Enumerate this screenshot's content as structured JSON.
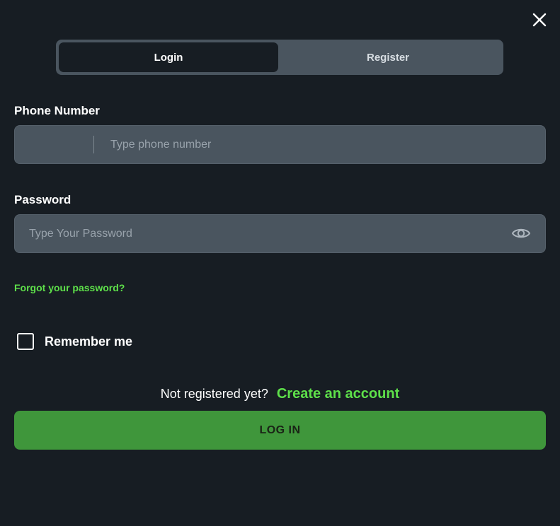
{
  "modal": {
    "close_icon": "close-icon"
  },
  "tabs": [
    {
      "label": "Login",
      "active": true
    },
    {
      "label": "Register",
      "active": false
    }
  ],
  "phone": {
    "label": "Phone Number",
    "placeholder": "Type phone number",
    "value": ""
  },
  "password": {
    "label": "Password",
    "placeholder": "Type Your Password",
    "value": "",
    "toggle_icon": "eye-icon"
  },
  "forgot_password": "Forgot your password?",
  "remember_me": {
    "label": "Remember me",
    "checked": false
  },
  "register_prompt": {
    "text": "Not registered yet?",
    "link": "Create an account"
  },
  "submit": {
    "label": "LOG IN"
  },
  "colors": {
    "background": "#171d23",
    "input_bg": "#4a555f",
    "accent_green": "#5ee04a",
    "button_green": "#3f963b"
  }
}
